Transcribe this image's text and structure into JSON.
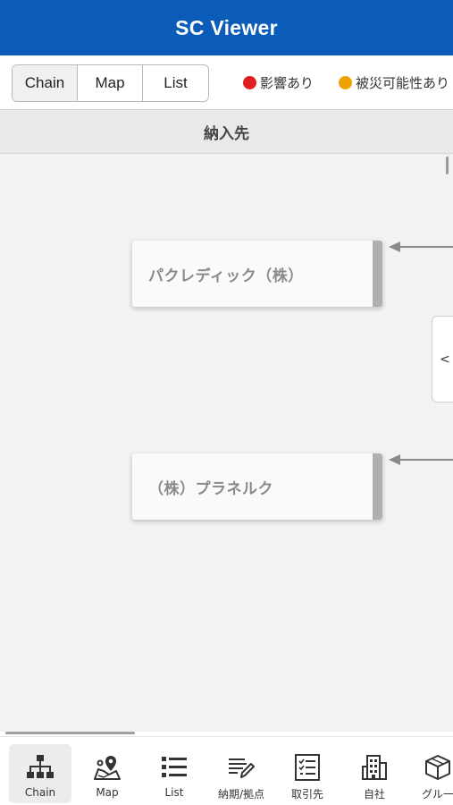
{
  "app": {
    "title": "SC Viewer"
  },
  "view_tabs": [
    {
      "label": "Chain",
      "active": true
    },
    {
      "label": "Map",
      "active": false
    },
    {
      "label": "List",
      "active": false
    }
  ],
  "legend": [
    {
      "label": "影響あり",
      "color": "#e02020"
    },
    {
      "label": "被災可能性あり",
      "color": "#f0a000"
    }
  ],
  "column": {
    "header": "納入先"
  },
  "nodes": [
    {
      "label": "パクレディック（株）"
    },
    {
      "label": "（株）プラネルク"
    }
  ],
  "side_tab": {
    "label": "<"
  },
  "bottom_nav": [
    {
      "label": "Chain",
      "icon": "hierarchy-icon",
      "active": true
    },
    {
      "label": "Map",
      "icon": "map-pin-icon",
      "active": false
    },
    {
      "label": "List",
      "icon": "list-icon",
      "active": false
    },
    {
      "label": "納期/拠点",
      "icon": "edit-lines-icon",
      "active": false
    },
    {
      "label": "取引先",
      "icon": "checklist-icon",
      "active": false
    },
    {
      "label": "自社",
      "icon": "building-icon",
      "active": false
    },
    {
      "label": "グル一",
      "icon": "box-icon",
      "active": false
    }
  ]
}
